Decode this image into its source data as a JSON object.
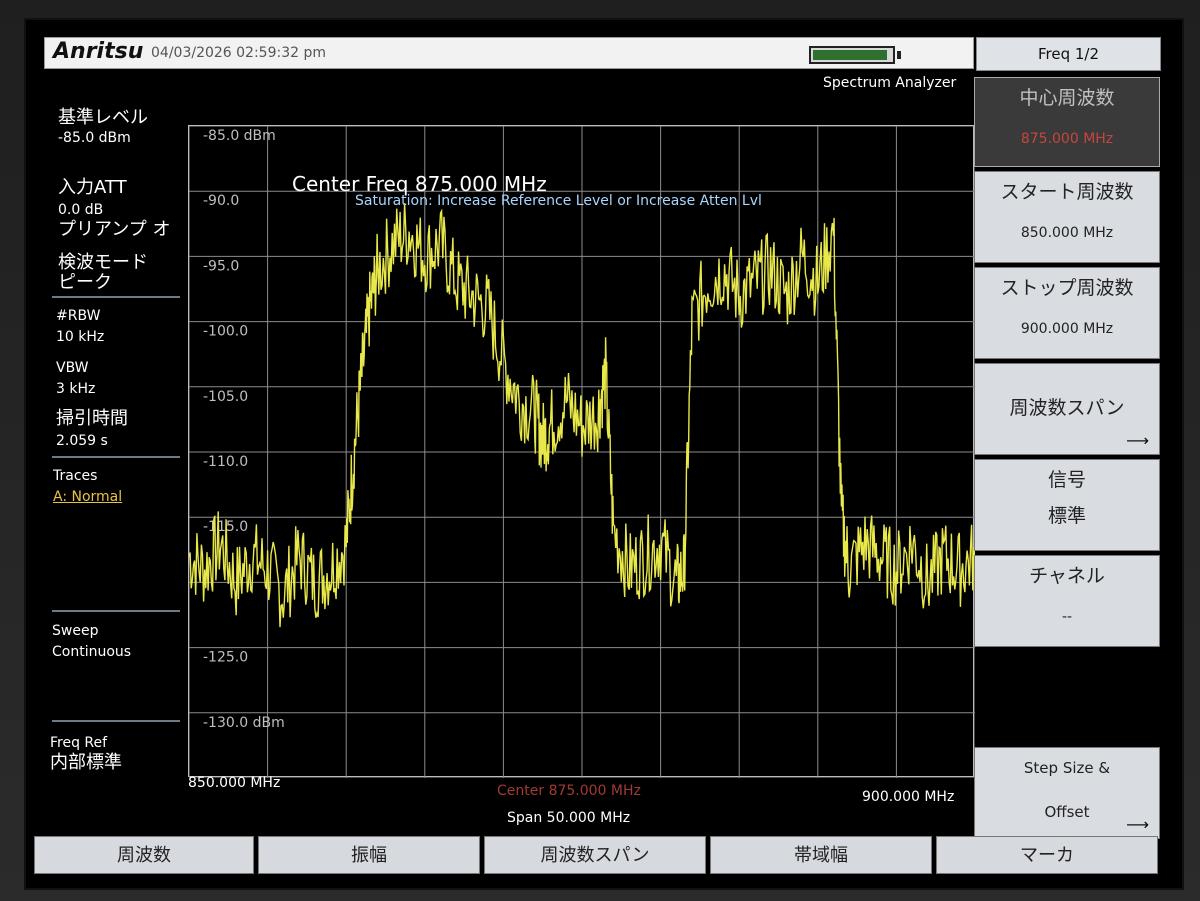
{
  "header": {
    "brand": "Anritsu",
    "datetime": "04/03/2026 02:59:32 pm",
    "mode": "Spectrum Analyzer",
    "battery_fraction": 0.95
  },
  "left_panel": {
    "ref_level_label": "基準レベル",
    "ref_level_value": "-85.0 dBm",
    "input_att_label": "入力ATT",
    "input_att_value": "0.0 dB",
    "preamp_label": "プリアンプ オ",
    "detect_label": "検波モード",
    "detect_value": "ピーク",
    "rbw_label": "#RBW",
    "rbw_value": "10 kHz",
    "vbw_label": "VBW",
    "vbw_value": "3 kHz",
    "sweep_time_label": "掃引時間",
    "sweep_time_value": "2.059 s",
    "traces_label": "Traces",
    "traces_value": "A: Normal",
    "sweep_label": "Sweep",
    "sweep_value": "Continuous",
    "freq_ref_label": "Freq Ref",
    "freq_ref_value": "内部標準"
  },
  "graph": {
    "title": "Center Freq 875.000 MHz",
    "warning": "Saturation: Increase Reference Level or Increase Atten Lvl",
    "y_labels": [
      "-85.0 dBm",
      "-90.0",
      "-95.0",
      "-100.0",
      "-105.0",
      "-110.0",
      "-115.0",
      "",
      "-125.0",
      "-130.0 dBm"
    ],
    "x_start": "850.000 MHz",
    "x_stop": "900.000 MHz",
    "center": "Center 875.000 MHz",
    "span": "Span 50.000 MHz",
    "trace_color": "#e8e84a",
    "grid_color": "#8c8c8c"
  },
  "chart_data": {
    "type": "line",
    "xlabel": "",
    "ylabel": "",
    "xlim": [
      850,
      900
    ],
    "ylim": [
      -135,
      -85
    ],
    "series": [
      {
        "x": [
          850,
          851,
          852,
          853,
          854,
          855,
          856,
          857,
          858,
          859,
          860,
          860.5,
          861,
          861.5,
          862,
          863,
          864,
          865,
          866,
          867,
          868,
          869,
          870,
          871,
          872,
          872.5,
          873,
          874,
          875,
          876,
          876.5,
          877,
          878,
          879,
          880,
          881,
          881.5,
          882,
          883,
          884,
          885,
          886,
          887,
          888,
          889,
          890,
          891,
          891.5,
          892,
          893,
          894,
          895,
          896,
          897,
          898,
          899,
          900
        ],
        "y": [
          -118,
          -119,
          -117,
          -120,
          -118,
          -119,
          -121,
          -118,
          -120,
          -119,
          -117,
          -110,
          -104,
          -99,
          -96,
          -94,
          -93,
          -95,
          -94,
          -97,
          -98,
          -99,
          -103,
          -106,
          -107,
          -109,
          -108,
          -106,
          -108,
          -107,
          -104,
          -116,
          -119,
          -118,
          -117,
          -120,
          -119,
          -100,
          -97,
          -96,
          -98,
          -97,
          -96,
          -98,
          -95,
          -97,
          -93,
          -115,
          -119,
          -117,
          -118,
          -119,
          -117,
          -120,
          -118,
          -119,
          -118
        ]
      }
    ]
  },
  "softkeys": {
    "menu_title": "Freq 1/2",
    "items": [
      {
        "label": "中心周波数",
        "value": "875.000 MHz",
        "active": true
      },
      {
        "label": "スタート周波数",
        "value": "850.000 MHz"
      },
      {
        "label": "ストップ周波数",
        "value": "900.000 MHz"
      },
      {
        "label": "周波数スパン",
        "value": ""
      },
      {
        "label": "信号",
        "value": "標準"
      },
      {
        "label": "チャネル",
        "value": "--"
      },
      {
        "label": "Step Size &",
        "value": "Offset"
      }
    ]
  },
  "bottom_menu": [
    "周波数",
    "振幅",
    "周波数スパン",
    "帯域幅",
    "マーカ"
  ]
}
